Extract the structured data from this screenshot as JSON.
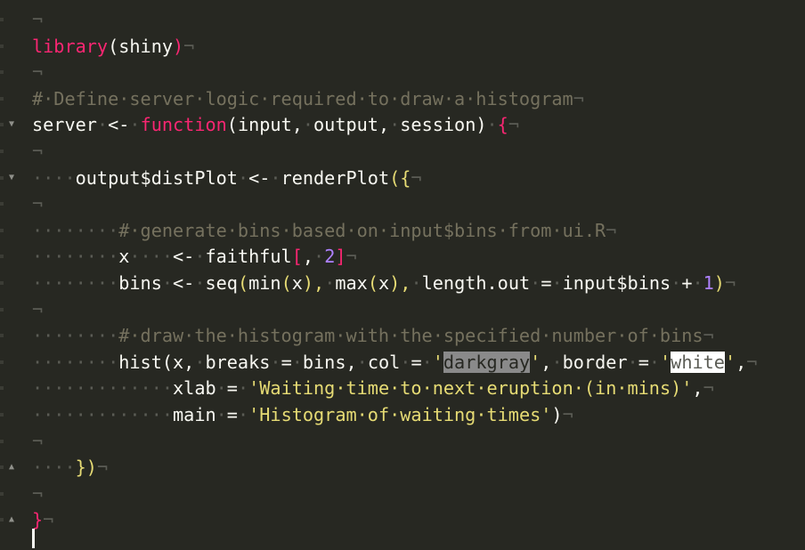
{
  "editor": {
    "theme": {
      "bg": "#272822",
      "fg": "#f8f8f2",
      "keyword": "#f92672",
      "number": "#ae81ff",
      "string": "#e6db74",
      "comment": "#75715e",
      "invisible": "#5b5c55"
    },
    "lines": [
      [
        {
          "t": "¬",
          "c": "ws"
        }
      ],
      [
        {
          "t": "library",
          "c": "kw"
        },
        {
          "t": "(shiny",
          "c": ""
        },
        {
          "t": ")",
          "c": "kw"
        },
        {
          "t": "¬",
          "c": "ws"
        }
      ],
      [
        {
          "t": "¬",
          "c": "ws"
        }
      ],
      [
        {
          "t": "#·Define·server·logic·required·to·draw·a·histogram",
          "c": "cmt"
        },
        {
          "t": "¬",
          "c": "ws"
        }
      ],
      [
        {
          "t": "server",
          "c": ""
        },
        {
          "t": "·",
          "c": "ws"
        },
        {
          "t": "<-",
          "c": ""
        },
        {
          "t": "·",
          "c": "ws"
        },
        {
          "t": "function",
          "c": "kw"
        },
        {
          "t": "(input,",
          "c": ""
        },
        {
          "t": "·",
          "c": "ws"
        },
        {
          "t": "output,",
          "c": ""
        },
        {
          "t": "·",
          "c": "ws"
        },
        {
          "t": "session)",
          "c": ""
        },
        {
          "t": "·",
          "c": "ws"
        },
        {
          "t": "{",
          "c": "kw"
        },
        {
          "t": "¬",
          "c": "ws"
        }
      ],
      [
        {
          "t": "¬",
          "c": "ws"
        }
      ],
      [
        {
          "t": "····",
          "c": "ws"
        },
        {
          "t": "output$distPlot",
          "c": ""
        },
        {
          "t": "·",
          "c": "ws"
        },
        {
          "t": "<-",
          "c": ""
        },
        {
          "t": "·",
          "c": "ws"
        },
        {
          "t": "renderPlot",
          "c": ""
        },
        {
          "t": "({",
          "c": "str"
        },
        {
          "t": "¬",
          "c": "ws"
        }
      ],
      [
        {
          "t": "¬",
          "c": "ws"
        }
      ],
      [
        {
          "t": "········",
          "c": "ws"
        },
        {
          "t": "#·generate·bins·based·on·input$bins·from·ui.R",
          "c": "cmt"
        },
        {
          "t": "¬",
          "c": "ws"
        }
      ],
      [
        {
          "t": "········",
          "c": "ws"
        },
        {
          "t": "x",
          "c": ""
        },
        {
          "t": "····",
          "c": "ws"
        },
        {
          "t": "<-",
          "c": ""
        },
        {
          "t": "·",
          "c": "ws"
        },
        {
          "t": "faithful",
          "c": ""
        },
        {
          "t": "[",
          "c": "kw"
        },
        {
          "t": ",",
          "c": ""
        },
        {
          "t": "·",
          "c": "ws"
        },
        {
          "t": "2",
          "c": "num"
        },
        {
          "t": "]",
          "c": "kw"
        },
        {
          "t": "¬",
          "c": "ws"
        }
      ],
      [
        {
          "t": "········",
          "c": "ws"
        },
        {
          "t": "bins",
          "c": ""
        },
        {
          "t": "·",
          "c": "ws"
        },
        {
          "t": "<-",
          "c": ""
        },
        {
          "t": "·",
          "c": "ws"
        },
        {
          "t": "seq",
          "c": ""
        },
        {
          "t": "(",
          "c": "str"
        },
        {
          "t": "min",
          "c": ""
        },
        {
          "t": "(",
          "c": "str"
        },
        {
          "t": "x",
          "c": ""
        },
        {
          "t": "),",
          "c": "str"
        },
        {
          "t": "·",
          "c": "ws"
        },
        {
          "t": "max",
          "c": ""
        },
        {
          "t": "(",
          "c": "str"
        },
        {
          "t": "x",
          "c": ""
        },
        {
          "t": "),",
          "c": "str"
        },
        {
          "t": "·",
          "c": "ws"
        },
        {
          "t": "length.out",
          "c": ""
        },
        {
          "t": "·",
          "c": "ws"
        },
        {
          "t": "=",
          "c": ""
        },
        {
          "t": "·",
          "c": "ws"
        },
        {
          "t": "input$bins",
          "c": ""
        },
        {
          "t": "·",
          "c": "ws"
        },
        {
          "t": "+",
          "c": ""
        },
        {
          "t": "·",
          "c": "ws"
        },
        {
          "t": "1",
          "c": "num"
        },
        {
          "t": ")",
          "c": "str"
        },
        {
          "t": "¬",
          "c": "ws"
        }
      ],
      [
        {
          "t": "¬",
          "c": "ws"
        }
      ],
      [
        {
          "t": "········",
          "c": "ws"
        },
        {
          "t": "#·draw·the·histogram·with·the·specified·number·of·bins",
          "c": "cmt"
        },
        {
          "t": "¬",
          "c": "ws"
        }
      ],
      [
        {
          "t": "········",
          "c": "ws"
        },
        {
          "t": "hist(x,",
          "c": ""
        },
        {
          "t": "·",
          "c": "ws"
        },
        {
          "t": "breaks",
          "c": ""
        },
        {
          "t": "·",
          "c": "ws"
        },
        {
          "t": "=",
          "c": ""
        },
        {
          "t": "·",
          "c": "ws"
        },
        {
          "t": "bins,",
          "c": ""
        },
        {
          "t": "·",
          "c": "ws"
        },
        {
          "t": "col",
          "c": ""
        },
        {
          "t": "·",
          "c": "ws"
        },
        {
          "t": "=",
          "c": ""
        },
        {
          "t": "·",
          "c": "ws"
        },
        {
          "t": "'",
          "c": "str"
        },
        {
          "t": "darkgray",
          "c": "sel-dark"
        },
        {
          "t": "'",
          "c": "str"
        },
        {
          "t": ",",
          "c": ""
        },
        {
          "t": "·",
          "c": "ws"
        },
        {
          "t": "border",
          "c": ""
        },
        {
          "t": "·",
          "c": "ws"
        },
        {
          "t": "=",
          "c": ""
        },
        {
          "t": "·",
          "c": "ws"
        },
        {
          "t": "'",
          "c": "str"
        },
        {
          "t": "white",
          "c": "sel-white"
        },
        {
          "t": "'",
          "c": "str"
        },
        {
          "t": ",",
          "c": ""
        },
        {
          "t": "¬",
          "c": "ws"
        }
      ],
      [
        {
          "t": "·············",
          "c": "ws"
        },
        {
          "t": "xlab",
          "c": ""
        },
        {
          "t": "·",
          "c": "ws"
        },
        {
          "t": "=",
          "c": ""
        },
        {
          "t": "·",
          "c": "ws"
        },
        {
          "t": "'Waiting·time·to·next·eruption·(in·mins)'",
          "c": "str"
        },
        {
          "t": ",",
          "c": ""
        },
        {
          "t": "¬",
          "c": "ws"
        }
      ],
      [
        {
          "t": "·············",
          "c": "ws"
        },
        {
          "t": "main",
          "c": ""
        },
        {
          "t": "·",
          "c": "ws"
        },
        {
          "t": "=",
          "c": ""
        },
        {
          "t": "·",
          "c": "ws"
        },
        {
          "t": "'Histogram·of·waiting·times'",
          "c": "str"
        },
        {
          "t": ")",
          "c": ""
        },
        {
          "t": "¬",
          "c": "ws"
        }
      ],
      [
        {
          "t": "¬",
          "c": "ws"
        }
      ],
      [
        {
          "t": "····",
          "c": "ws"
        },
        {
          "t": "})",
          "c": "str"
        },
        {
          "t": "¬",
          "c": "ws"
        }
      ],
      [
        {
          "t": "¬",
          "c": "ws"
        }
      ],
      [
        {
          "t": "}",
          "c": "kw"
        },
        {
          "t": "¬",
          "c": "ws"
        }
      ]
    ],
    "fold_markers": {
      "4": "▼",
      "6": "▼",
      "17": "▲",
      "19": "▲"
    }
  }
}
